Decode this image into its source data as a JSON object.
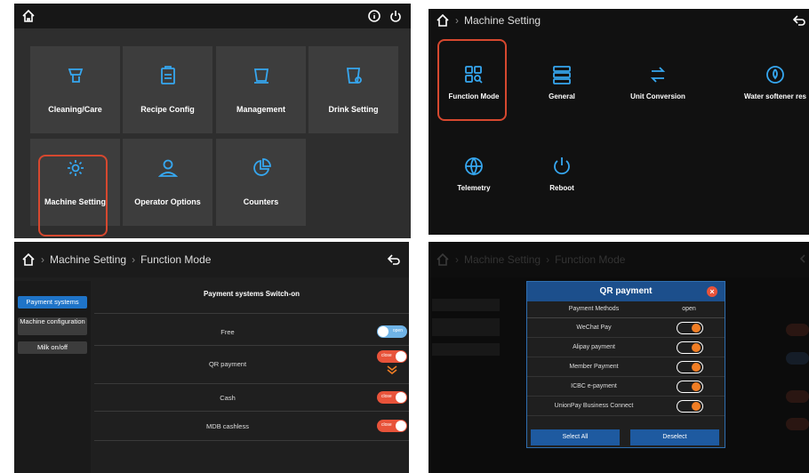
{
  "colors": {
    "accent": "#36a7f0",
    "highlight": "#d6482f",
    "toggle_on": "#f07d24",
    "toggle_close": "#e8533a",
    "toggle_open": "#6fb3e6",
    "modal_header": "#1c4f8c"
  },
  "panel1": {
    "tiles": [
      {
        "label": "Cleaning/Care",
        "icon": "hand-wash-icon"
      },
      {
        "label": "Recipe Config",
        "icon": "clipboard-icon"
      },
      {
        "label": "Management",
        "icon": "cup-icon"
      },
      {
        "label": "Drink Setting",
        "icon": "cup-gear-icon"
      },
      {
        "label": "Machine Setting",
        "icon": "gear-icon"
      },
      {
        "label": "Operator Options",
        "icon": "user-icon"
      },
      {
        "label": "Counters",
        "icon": "pie-chart-icon"
      }
    ]
  },
  "panel2": {
    "breadcrumb": "Machine Setting",
    "items": [
      {
        "label": "Function Mode",
        "icon": "function-grid-icon"
      },
      {
        "label": "General",
        "icon": "list-icon"
      },
      {
        "label": "Unit Conversion",
        "icon": "convert-icon"
      },
      {
        "label": "Water softener res",
        "icon": "water-filter-icon"
      },
      {
        "label": "Telemetry",
        "icon": "globe-icon"
      },
      {
        "label": "Reboot",
        "icon": "power-icon"
      }
    ]
  },
  "panel3": {
    "breadcrumb1": "Machine Setting",
    "breadcrumb2": "Function Mode",
    "sidebar": [
      "Payment systems",
      "Machine configuration",
      "Milk on/off"
    ],
    "header": "Payment systems Switch-on",
    "rows": [
      {
        "label": "Free",
        "state": "open"
      },
      {
        "label": "QR payment",
        "state": "close"
      },
      {
        "label": "Cash",
        "state": "close"
      },
      {
        "label": "MDB cashless",
        "state": "close"
      }
    ]
  },
  "panel4": {
    "breadcrumb1": "Machine Setting",
    "breadcrumb2": "Function Mode",
    "modal": {
      "title": "QR payment",
      "col1": "Payment Methods",
      "col2": "open",
      "rows": [
        "WeChat Pay",
        "Alipay payment",
        "Member Payment",
        "ICBC e-payment",
        "UnionPay Business Connect"
      ],
      "select_all": "Select All",
      "deselect": "Deselect"
    }
  }
}
